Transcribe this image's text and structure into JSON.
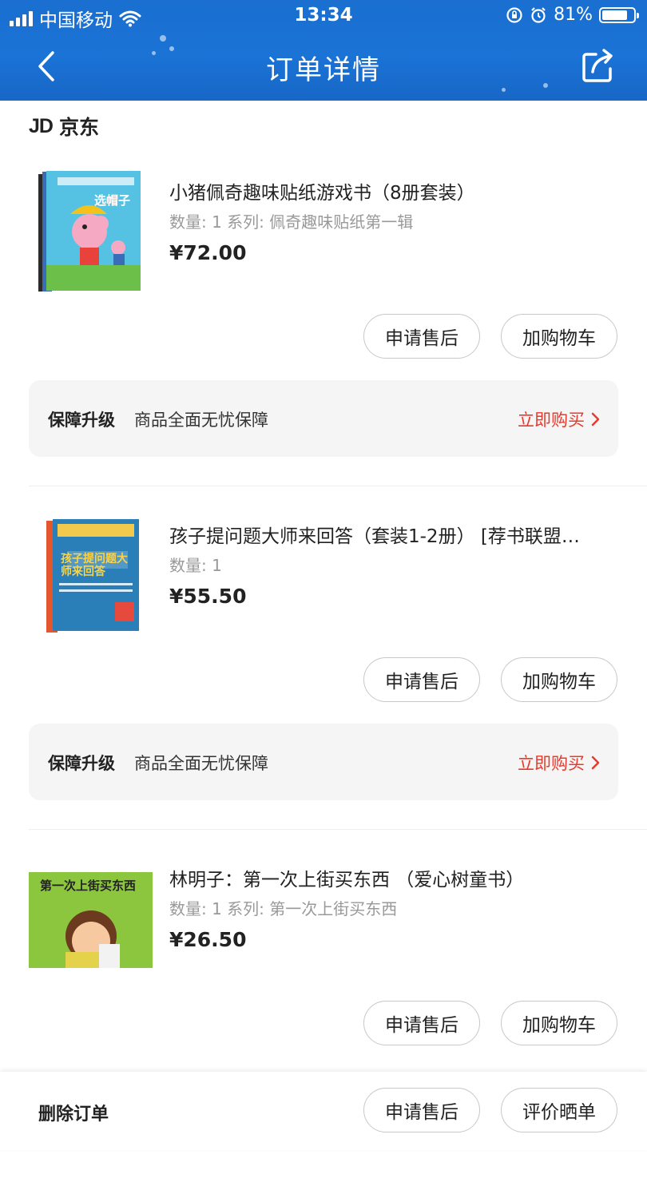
{
  "status_bar": {
    "carrier": "中国移动",
    "time": "13:34",
    "battery": "81%",
    "battery_level": 0.81
  },
  "nav": {
    "title": "订单详情",
    "back_icon": "chevron-left-icon",
    "share_icon": "share-icon"
  },
  "shop": {
    "logo": "JD",
    "name": "京东"
  },
  "products": [
    {
      "title": "小猪佩奇趣味贴纸游戏书（8册套装）",
      "meta": "数量: 1  系列: 佩奇趣味贴纸第一辑",
      "price": "¥72.00",
      "cover_text": "选帽子",
      "btn_aftersale": "申请售后",
      "btn_cart": "加购物车"
    },
    {
      "title": "孩子提问题大师来回答（套装1-2册）  [荐书联盟…",
      "meta": "数量: 1",
      "price": "¥55.50",
      "cover_text": "孩子提问题大师来回答",
      "btn_aftersale": "申请售后",
      "btn_cart": "加购物车"
    },
    {
      "title": "林明子：第一次上街买东西 （爱心树童书）",
      "meta": "数量: 1  系列: 第一次上街买东西",
      "price": "¥26.50",
      "cover_text": "第一次上街买东西",
      "btn_aftersale": "申请售后",
      "btn_cart": "加购物车"
    }
  ],
  "guarantee": {
    "title": "保障升级",
    "desc": "商品全面无忧保障",
    "action": "立即购买"
  },
  "footer": {
    "delete": "删除订单",
    "aftersale": "申请售后",
    "review": "评价晒单"
  },
  "colors": {
    "header_blue": "#1b73d6",
    "accent_red": "#e83a2c"
  }
}
